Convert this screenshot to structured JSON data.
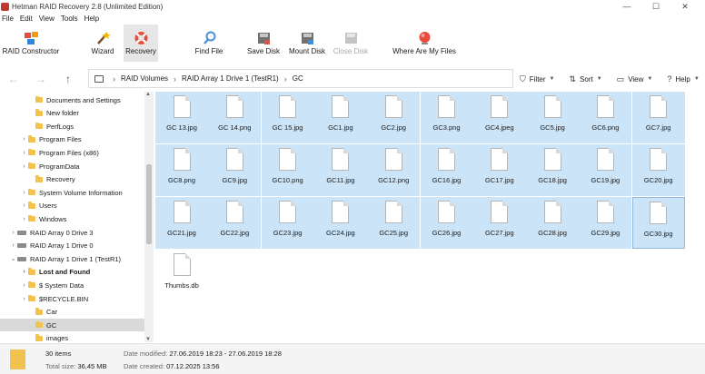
{
  "window": {
    "title": "Hetman RAID Recovery 2.8 (Unlimited Edition)",
    "min": "—",
    "max": "☐",
    "close": "✕"
  },
  "menu": [
    "File",
    "Edit",
    "View",
    "Tools",
    "Help"
  ],
  "ribbon": [
    {
      "label": "RAID Constructor",
      "icon": "raid-constructor-icon"
    },
    {
      "label": "Wizard",
      "icon": "wizard-icon"
    },
    {
      "label": "Recovery",
      "icon": "lifebuoy-icon"
    },
    {
      "label": "Find File",
      "icon": "magnifier-icon"
    },
    {
      "label": "Save Disk",
      "icon": "save-disk-icon"
    },
    {
      "label": "Mount Disk",
      "icon": "mount-disk-icon"
    },
    {
      "label": "Close Disk",
      "icon": "close-disk-icon"
    },
    {
      "label": "Where Are My Files",
      "icon": "where-are-my-files-icon"
    }
  ],
  "nav": {
    "back": "←",
    "forward": "→",
    "up": "↑"
  },
  "breadcrumb": [
    "RAID Volumes",
    "RAID Array 1 Drive 1 (TestR1)",
    "GC"
  ],
  "tools": [
    {
      "label": "Filter",
      "icon": "⛉"
    },
    {
      "label": "Sort",
      "icon": "⇅"
    },
    {
      "label": "View",
      "icon": "▭"
    },
    {
      "label": "Help",
      "icon": "?"
    }
  ],
  "tree": [
    {
      "label": "Documents and Settings",
      "chev": ""
    },
    {
      "label": "New folder",
      "chev": ""
    },
    {
      "label": "PerfLogs",
      "chev": ""
    },
    {
      "label": "Program Files",
      "chev": "›"
    },
    {
      "label": "Program Files (x86)",
      "chev": "›"
    },
    {
      "label": "ProgramData",
      "chev": "›"
    },
    {
      "label": "Recovery",
      "chev": ""
    },
    {
      "label": "System Volume Information",
      "chev": "›"
    },
    {
      "label": "Users",
      "chev": "›"
    },
    {
      "label": "Windows",
      "chev": "›"
    },
    {
      "label": "RAID Array 0 Drive 3",
      "chev": "›"
    },
    {
      "label": "RAID Array 1 Drive 0",
      "chev": "›"
    },
    {
      "label": "RAID Array 1 Drive 1 (TestR1)",
      "chev": "⌄"
    },
    {
      "label": "Lost and Found",
      "chev": "›"
    },
    {
      "label": "$ System Data",
      "chev": "›"
    },
    {
      "label": "$RECYCLE.BIN",
      "chev": "›"
    },
    {
      "label": "Car",
      "chev": ""
    },
    {
      "label": "GC",
      "chev": ""
    },
    {
      "label": "images",
      "chev": ""
    }
  ],
  "files": [
    "GC 13.jpg",
    "GC 14.png",
    "GC 15.jpg",
    "GC1.jpg",
    "GC2.jpg",
    "GC3.png",
    "GC4.jpeg",
    "GC5.jpg",
    "GC6.png",
    "GC7.jpg",
    "GC8.png",
    "GC9.jpg",
    "GC10.png",
    "GC11.jpg",
    "GC12.png",
    "GC16.jpg",
    "GC17.jpg",
    "GC18.jpg",
    "GC19.jpg",
    "GC20.jpg",
    "GC21.jpg",
    "GC22.jpg",
    "GC23.jpg",
    "GC24.jpg",
    "GC25.jpg",
    "GC26.jpg",
    "GC27.jpg",
    "GC28.jpg",
    "GC29.jpg",
    "GC30.jpg",
    "Thumbs.db"
  ],
  "status": {
    "items": "30 items",
    "total_size_label": "Total size:",
    "total_size": "36,45 MB",
    "modified_label": "Date modified:",
    "modified": "27.06.2019 18:23 - 27.06.2019 18:28",
    "created_label": "Date created:",
    "created": "07.12.2025 13:56"
  },
  "colors": {
    "selection": "#cce4f7",
    "folder": "#f2c24f"
  }
}
